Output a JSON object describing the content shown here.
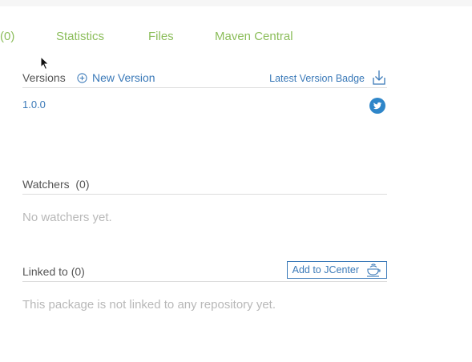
{
  "tabs": [
    {
      "label": "(0)"
    },
    {
      "label": "Statistics"
    },
    {
      "label": "Files"
    },
    {
      "label": "Maven Central"
    }
  ],
  "versions": {
    "title": "Versions",
    "new_version_label": "New Version",
    "latest_badge_label": "Latest Version Badge",
    "items": [
      {
        "version": "1.0.0"
      }
    ]
  },
  "watchers": {
    "title": "Watchers  (0)",
    "empty_text": "No watchers yet."
  },
  "linked": {
    "title": "Linked to (0)",
    "add_button_label": "Add to JCenter",
    "empty_text": "This package is not linked to any repository yet."
  },
  "colors": {
    "tab_green": "#8bbd5a",
    "link_blue": "#3a79b8",
    "twitter_blue": "#2f86c9",
    "muted_gray": "#b8b8b8"
  },
  "icons": {
    "new_version": "plus-circle-icon",
    "badge": "download-icon",
    "share": "twitter-icon",
    "jcenter": "cup-icon"
  }
}
